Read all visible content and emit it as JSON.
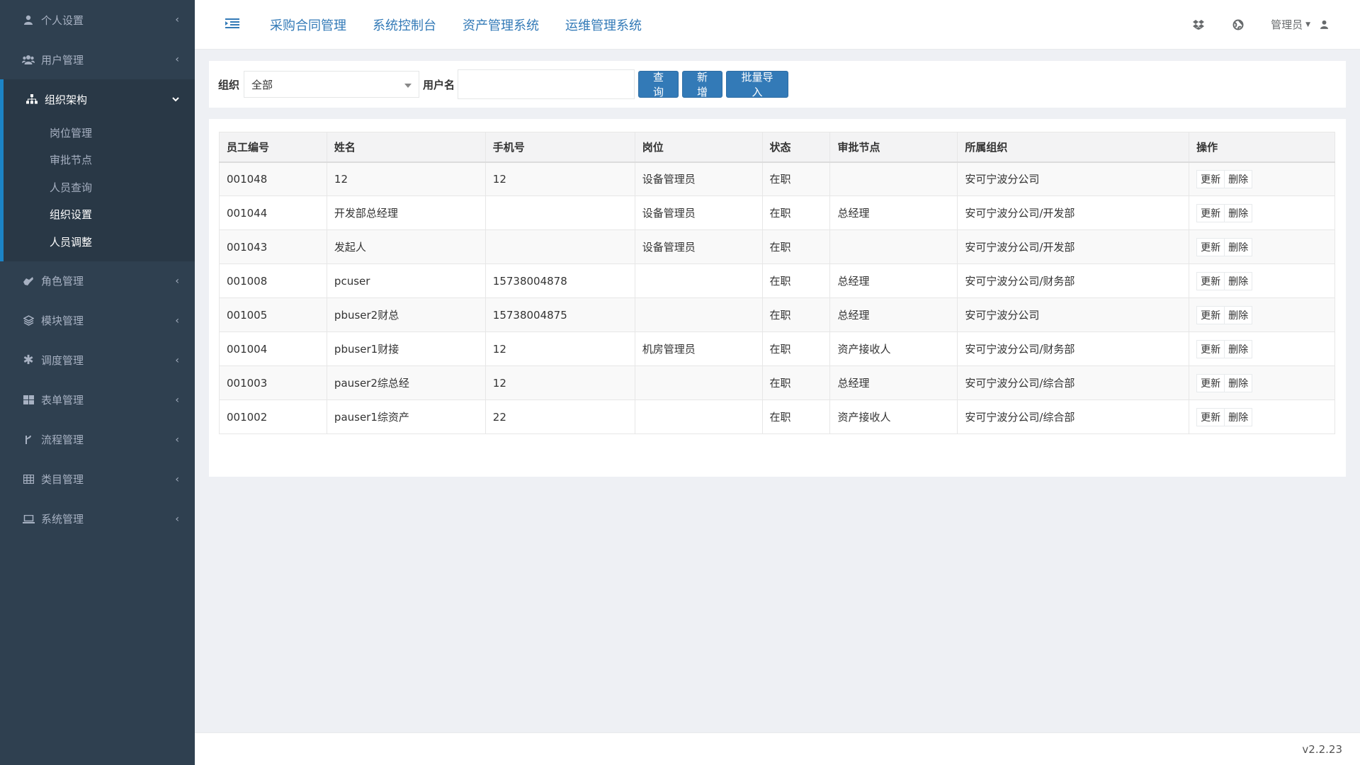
{
  "sidebar": {
    "items": [
      {
        "label": "个人设置",
        "icon": "user-icon"
      },
      {
        "label": "用户管理",
        "icon": "users-icon"
      },
      {
        "label": "组织架构",
        "icon": "sitemap-icon",
        "expanded": true,
        "children": [
          "岗位管理",
          "审批节点",
          "人员查询",
          "组织设置",
          "人员调整"
        ]
      },
      {
        "label": "角色管理",
        "icon": "role-icon"
      },
      {
        "label": "模块管理",
        "icon": "module-icon"
      },
      {
        "label": "调度管理",
        "icon": "asterisk-icon"
      },
      {
        "label": "表单管理",
        "icon": "grid-icon"
      },
      {
        "label": "流程管理",
        "icon": "flow-icon"
      },
      {
        "label": "类目管理",
        "icon": "table-icon"
      },
      {
        "label": "系统管理",
        "icon": "laptop-icon"
      }
    ]
  },
  "topbar": {
    "links": [
      "采购合同管理",
      "系统控制台",
      "资产管理系统",
      "运维管理系统"
    ],
    "admin_label": "管理员"
  },
  "search": {
    "org_label": "组织",
    "org_value": "全部",
    "user_label": "用户名",
    "user_value": "",
    "query_button": "查询",
    "add_button": "新增",
    "import_button": "批量导入"
  },
  "table": {
    "headers": [
      "员工编号",
      "姓名",
      "手机号",
      "岗位",
      "状态",
      "审批节点",
      "所属组织",
      "操作"
    ],
    "update_label": "更新",
    "delete_label": "删除",
    "rows": [
      {
        "id": "001048",
        "name": "12",
        "phone": "12",
        "post": "设备管理员",
        "status": "在职",
        "node": "",
        "org": "安可宁波分公司"
      },
      {
        "id": "001044",
        "name": "开发部总经理",
        "phone": "",
        "post": "设备管理员",
        "status": "在职",
        "node": "总经理",
        "org": "安可宁波分公司/开发部"
      },
      {
        "id": "001043",
        "name": "发起人",
        "phone": "",
        "post": "设备管理员",
        "status": "在职",
        "node": "",
        "org": "安可宁波分公司/开发部"
      },
      {
        "id": "001008",
        "name": "pcuser",
        "phone": "15738004878",
        "post": "",
        "status": "在职",
        "node": "总经理",
        "org": "安可宁波分公司/财务部"
      },
      {
        "id": "001005",
        "name": "pbuser2财总",
        "phone": "15738004875",
        "post": "",
        "status": "在职",
        "node": "总经理",
        "org": "安可宁波分公司"
      },
      {
        "id": "001004",
        "name": "pbuser1财接",
        "phone": "12",
        "post": "机房管理员",
        "status": "在职",
        "node": "资产接收人",
        "org": "安可宁波分公司/财务部"
      },
      {
        "id": "001003",
        "name": "pauser2综总经",
        "phone": "12",
        "post": "",
        "status": "在职",
        "node": "总经理",
        "org": "安可宁波分公司/综合部"
      },
      {
        "id": "001002",
        "name": "pauser1综资产",
        "phone": "22",
        "post": "",
        "status": "在职",
        "node": "资产接收人",
        "org": "安可宁波分公司/综合部"
      }
    ]
  },
  "footer": {
    "version": "v2.2.23"
  },
  "colors": {
    "sidebar_bg": "#2f4050",
    "accent": "#337ab7",
    "active_border": "#1c84c6"
  }
}
